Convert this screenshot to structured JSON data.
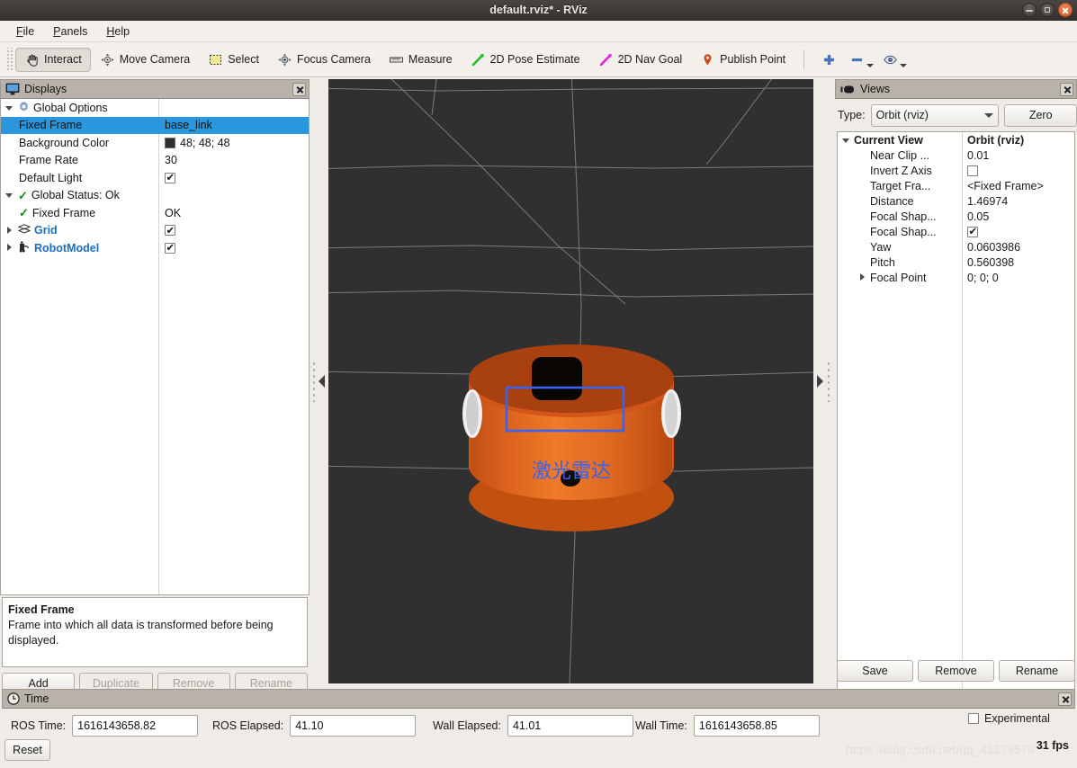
{
  "window": {
    "title": "default.rviz* - RViz",
    "controls": [
      {
        "name": "minimize",
        "glyph": "minimize-icon"
      },
      {
        "name": "maximize",
        "glyph": "maximize-icon"
      },
      {
        "name": "close",
        "glyph": "close-icon"
      }
    ]
  },
  "menubar": {
    "items": [
      {
        "label": "File",
        "mnemonic": "F"
      },
      {
        "label": "Panels",
        "mnemonic": "P"
      },
      {
        "label": "Help",
        "mnemonic": "H"
      }
    ]
  },
  "toolbar": {
    "buttons": [
      {
        "label": "Interact",
        "icon": "hand-cursor-icon",
        "active": true
      },
      {
        "label": "Move Camera",
        "icon": "move-camera-icon",
        "active": false
      },
      {
        "label": "Select",
        "icon": "selection-rect-icon",
        "active": false
      },
      {
        "label": "Focus Camera",
        "icon": "focus-camera-icon",
        "active": false
      },
      {
        "label": "Measure",
        "icon": "ruler-icon",
        "active": false
      },
      {
        "label": "2D Pose Estimate",
        "icon": "green-arrow-icon",
        "active": false
      },
      {
        "label": "2D Nav Goal",
        "icon": "magenta-arrow-icon",
        "active": false
      },
      {
        "label": "Publish Point",
        "icon": "map-pin-icon",
        "active": false
      }
    ],
    "extras": [
      {
        "name": "add-tool-button",
        "icon": "plus-icon",
        "color": "#3a6fb5"
      },
      {
        "name": "remove-tool-button",
        "icon": "minus-icon",
        "color": "#3a6fb5",
        "dropdown": true
      },
      {
        "name": "visibility-button",
        "icon": "eye-icon",
        "dropdown": true
      }
    ]
  },
  "displays": {
    "title": "Displays",
    "icon": "monitor-icon",
    "rows": [
      {
        "label": "Global Options",
        "value": "",
        "indent": 0,
        "arrow": "down",
        "icon": "gear-icon",
        "kind": "text",
        "selected": false,
        "blue": false
      },
      {
        "label": "Fixed Frame",
        "value": "base_link",
        "indent": 1,
        "arrow": "none",
        "icon": "",
        "kind": "text",
        "selected": true,
        "blue": false
      },
      {
        "label": "Background Color",
        "value": "48; 48; 48",
        "indent": 1,
        "arrow": "none",
        "icon": "",
        "kind": "color",
        "swatch": "#303030",
        "selected": false,
        "blue": false
      },
      {
        "label": "Frame Rate",
        "value": "30",
        "indent": 1,
        "arrow": "none",
        "icon": "",
        "kind": "text",
        "selected": false,
        "blue": false
      },
      {
        "label": "Default Light",
        "value": "",
        "indent": 1,
        "arrow": "none",
        "icon": "",
        "kind": "check",
        "checked": true,
        "selected": false,
        "blue": false
      },
      {
        "label": "Global Status: Ok",
        "value": "",
        "indent": 0,
        "arrow": "down",
        "icon": "green-check-icon",
        "kind": "text",
        "selected": false,
        "blue": false
      },
      {
        "label": "Fixed Frame",
        "value": "OK",
        "indent": 1,
        "arrow": "none",
        "icon": "green-check-icon",
        "kind": "text",
        "selected": false,
        "blue": false
      },
      {
        "label": "Grid",
        "value": "",
        "indent": 0,
        "arrow": "right",
        "icon": "grid-icon",
        "kind": "check",
        "checked": true,
        "selected": false,
        "blue": true
      },
      {
        "label": "RobotModel",
        "value": "",
        "indent": 0,
        "arrow": "right",
        "icon": "robot-icon",
        "kind": "check",
        "checked": true,
        "selected": false,
        "blue": true
      }
    ],
    "description": {
      "heading": "Fixed Frame",
      "text": "Frame into which all data is transformed before being displayed."
    },
    "buttons": [
      {
        "label": "Add",
        "enabled": true
      },
      {
        "label": "Duplicate",
        "enabled": false
      },
      {
        "label": "Remove",
        "enabled": false
      },
      {
        "label": "Rename",
        "enabled": false
      }
    ]
  },
  "views": {
    "title": "Views",
    "icon": "camera-views-icon",
    "type_label": "Type:",
    "type_value": "Orbit (rviz)",
    "zero_label": "Zero",
    "rows": [
      {
        "label": "Current View",
        "value": "Orbit (rviz)",
        "indent": 0,
        "arrow": "down",
        "kind": "text",
        "header": true
      },
      {
        "label": "Near Clip ...",
        "value": "0.01",
        "indent": 1,
        "arrow": "none",
        "kind": "text",
        "header": false
      },
      {
        "label": "Invert Z Axis",
        "value": "",
        "indent": 1,
        "arrow": "none",
        "kind": "check",
        "checked": false,
        "header": false
      },
      {
        "label": "Target Fra...",
        "value": "<Fixed Frame>",
        "indent": 1,
        "arrow": "none",
        "kind": "text",
        "header": false
      },
      {
        "label": "Distance",
        "value": "1.46974",
        "indent": 1,
        "arrow": "none",
        "kind": "text",
        "header": false
      },
      {
        "label": "Focal Shap...",
        "value": "0.05",
        "indent": 1,
        "arrow": "none",
        "kind": "text",
        "header": false
      },
      {
        "label": "Focal Shap...",
        "value": "",
        "indent": 1,
        "arrow": "none",
        "kind": "check",
        "checked": true,
        "header": false
      },
      {
        "label": "Yaw",
        "value": "0.0603986",
        "indent": 1,
        "arrow": "none",
        "kind": "text",
        "header": false
      },
      {
        "label": "Pitch",
        "value": "0.560398",
        "indent": 1,
        "arrow": "none",
        "kind": "text",
        "header": false
      },
      {
        "label": "Focal Point",
        "value": "0; 0; 0",
        "indent": 1,
        "arrow": "right",
        "kind": "text",
        "header": false
      }
    ],
    "buttons": [
      {
        "label": "Save"
      },
      {
        "label": "Remove"
      },
      {
        "label": "Rename"
      }
    ]
  },
  "viewport": {
    "background_color": "#303030",
    "grid_color": "#9a9a9a",
    "robot": {
      "body_color": "#d4551a",
      "body_top_color": "#a8400f",
      "lidar_box_color": "#090604",
      "wheel_color": "#e8e8e8",
      "annotation_color": "#3b63ef",
      "annotation_label": "激光雷达"
    }
  },
  "time": {
    "title": "Time",
    "icon": "clock-icon",
    "fields": [
      {
        "label": "ROS Time:",
        "value": "1616143658.82"
      },
      {
        "label": "ROS Elapsed:",
        "value": "41.10"
      },
      {
        "label": "Wall Time:",
        "value": "1616143658.85"
      },
      {
        "label": "Wall Elapsed:",
        "value": "41.01"
      }
    ],
    "reset_label": "Reset",
    "experimental_label": "Experimental",
    "experimental_checked": false,
    "fps": "31 fps"
  },
  "watermark": "https://blog.csdn.net/qq_43379579"
}
